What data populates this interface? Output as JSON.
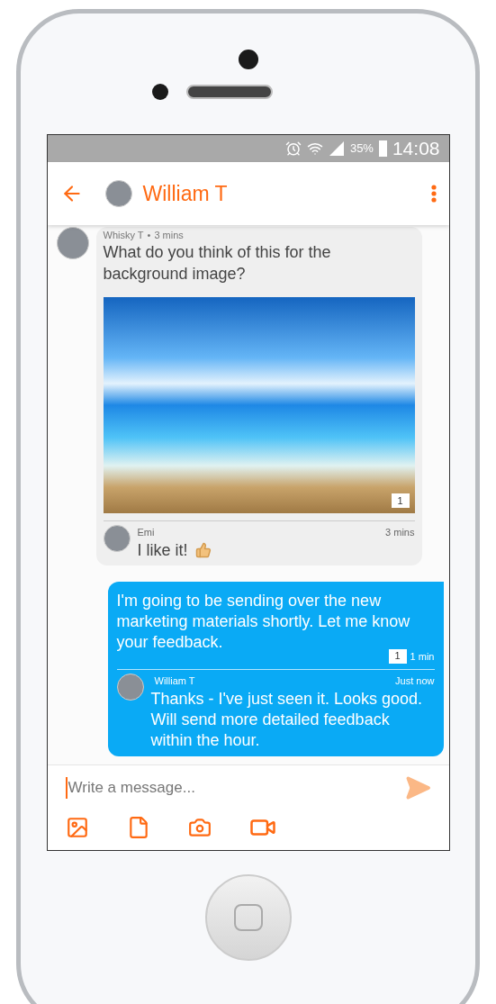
{
  "status_bar": {
    "battery": "35%",
    "time": "14:08"
  },
  "header": {
    "title": "William T"
  },
  "messages": [
    {
      "kind": "received",
      "author": "Whisky T",
      "separator": "•",
      "time": "3 mins",
      "text": "What do you think of this for the background image?",
      "comment_count": "1",
      "reply": {
        "author": "Emi",
        "time": "3 mins",
        "text": "I like it!"
      }
    },
    {
      "kind": "sent",
      "text": "I'm going to be sending over the new marketing materials shortly. Let me know your feedback.",
      "comment_count": "1",
      "time": "1 min",
      "reply": {
        "author": "William T",
        "time": "Just now",
        "text": "Thanks - I've just seen it. Looks good. Will send more detailed feedback within the hour."
      }
    }
  ],
  "composer": {
    "placeholder": "Write a message..."
  }
}
